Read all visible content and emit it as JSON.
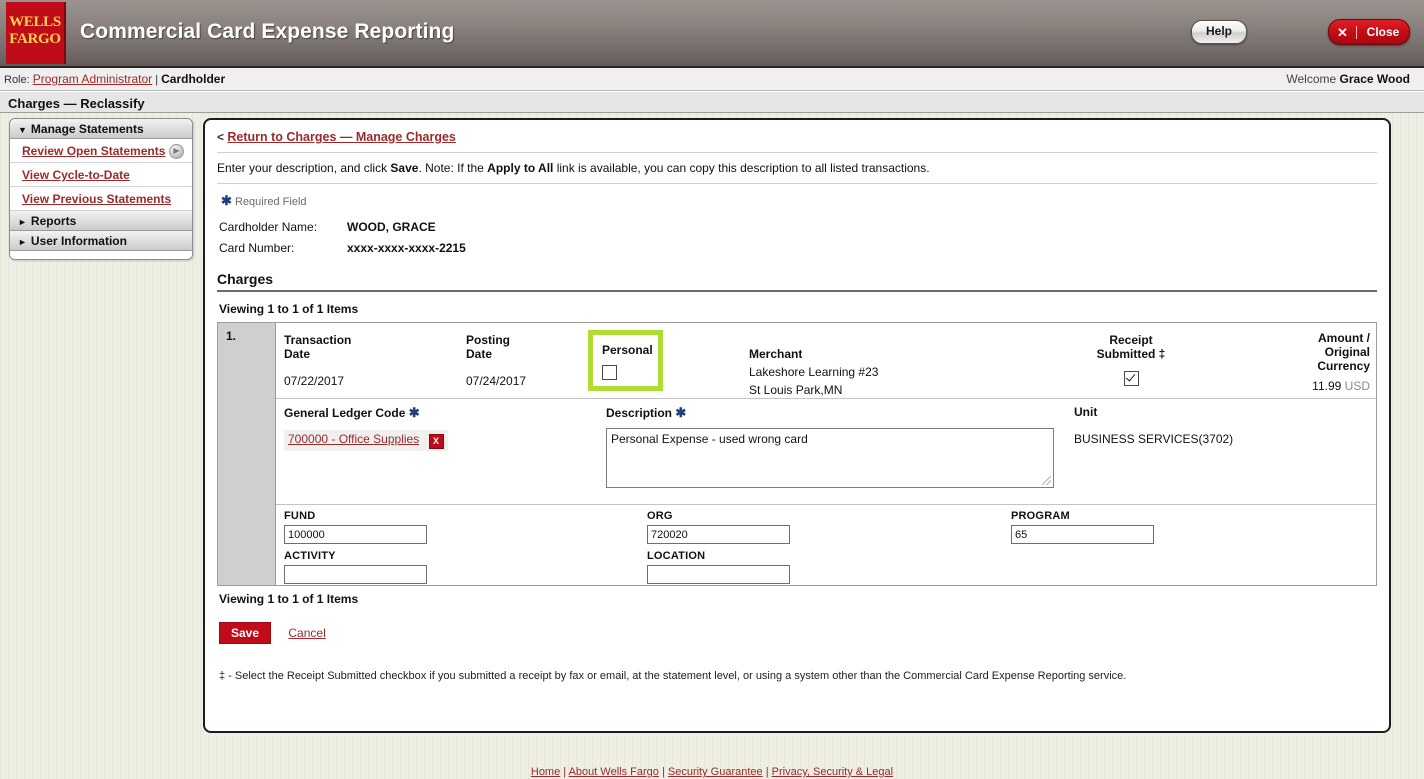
{
  "header": {
    "logo_line1": "WELLS",
    "logo_line2": "FARGO",
    "app_title": "Commercial Card Expense Reporting",
    "help_label": "Help",
    "close_x": "✕",
    "close_label": "Close",
    "brand_red": "#c00c18"
  },
  "rolebar": {
    "role_prefix": "Role:",
    "role_link": "Program Administrator",
    "role_divider": "|",
    "role_current": "Cardholder",
    "welcome_prefix": "Welcome",
    "welcome_name": "Grace Wood"
  },
  "page_title": "Charges — Reclassify",
  "sidebar": {
    "groups": [
      {
        "label": "Manage Statements",
        "icon": "triangle-down-icon",
        "marker": "▼",
        "expanded": true,
        "links": [
          {
            "label": "Review Open Statements",
            "has_go_icon": true,
            "go_icon": "▶"
          },
          {
            "label": "View Cycle-to-Date",
            "has_go_icon": false
          },
          {
            "label": "View Previous Statements",
            "has_go_icon": false
          }
        ]
      },
      {
        "label": "Reports",
        "icon": "triangle-right-icon",
        "marker": "►",
        "expanded": false,
        "links": []
      },
      {
        "label": "User Information",
        "icon": "triangle-right-icon",
        "marker": "►",
        "expanded": false,
        "links": []
      }
    ]
  },
  "main": {
    "return_prefix": "<",
    "return_link": "Return to Charges — Manage Charges",
    "instructions_1": "Enter your description, and click ",
    "instructions_save": "Save",
    "instructions_2": ". Note: If the ",
    "instructions_apply": "Apply to All",
    "instructions_3": " link is available, you can copy this description to all listed transactions.",
    "required_star": "✱",
    "required_label": "Required Field",
    "cardholder_name_label": "Cardholder Name:",
    "cardholder_name_value": "WOOD, GRACE",
    "card_number_label": "Card Number:",
    "card_number_value": "xxxx-xxxx-xxxx-2215",
    "charges_heading": "Charges",
    "viewing_top": "Viewing 1 to 1 of 1 Items",
    "viewing_bottom": "Viewing 1 to 1 of 1 Items",
    "save_label": "Save",
    "cancel_label": "Cancel",
    "footnote": "‡ - Select the Receipt Submitted checkbox if you submitted a receipt by fax or email, at the statement level, or using a system other than the Commercial Card Expense Reporting service.",
    "highlight_color": "#aede34"
  },
  "charge": {
    "index": "1.",
    "transaction_date_label_l1": "Transaction",
    "transaction_date_label_l2": "Date",
    "transaction_date_value": "07/22/2017",
    "posting_date_label_l1": "Posting",
    "posting_date_label_l2": "Date",
    "posting_date_value": "07/24/2017",
    "personal_label": "Personal",
    "personal_checked": false,
    "merchant_label": "Merchant",
    "merchant_name": "Lakeshore Learning #23",
    "merchant_city": "St Louis Park,MN",
    "receipt_label_l1": "Receipt",
    "receipt_label_l2": "Submitted ‡",
    "receipt_checked": true,
    "amount_label_l1": "Amount /",
    "amount_label_l2": "Original",
    "amount_label_l3": "Currency",
    "amount_value": "11.99",
    "amount_currency": "USD",
    "gl_code_label": "General Ledger Code",
    "gl_code_value": "700000 - Office Supplies",
    "gl_delete_icon": "X",
    "description_label": "Description",
    "description_value": "Personal Expense - used wrong card",
    "unit_label": "Unit",
    "unit_value": "BUSINESS SERVICES(3702)",
    "fields": [
      {
        "label": "FUND",
        "value": "100000"
      },
      {
        "label": "ORG",
        "value": "720020"
      },
      {
        "label": "PROGRAM",
        "value": "65"
      },
      {
        "label": "ACTIVITY",
        "value": ""
      },
      {
        "label": "LOCATION",
        "value": ""
      }
    ]
  },
  "footer": {
    "links": [
      "Home",
      "About Wells Fargo",
      "Security Guarantee",
      "Privacy, Security & Legal"
    ],
    "separator": " | "
  }
}
